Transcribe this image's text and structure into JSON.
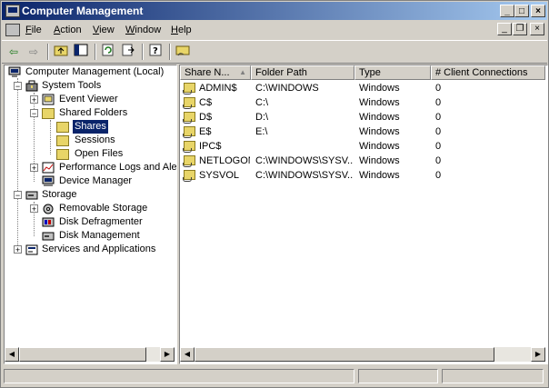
{
  "window": {
    "title": "Computer Management"
  },
  "menu": [
    {
      "label": "File",
      "accel": "F",
      "rest": "ile"
    },
    {
      "label": "Action",
      "accel": "A",
      "rest": "ction"
    },
    {
      "label": "View",
      "accel": "V",
      "rest": "iew"
    },
    {
      "label": "Window",
      "accel": "W",
      "rest": "indow"
    },
    {
      "label": "Help",
      "accel": "H",
      "rest": "elp"
    }
  ],
  "toolbar": {
    "icons": [
      "back-arrow-icon",
      "forward-arrow-icon",
      "up-folder-icon",
      "show-hide-tree-icon",
      "refresh-icon",
      "export-list-icon",
      "help-icon",
      "new-share-icon"
    ]
  },
  "tree": {
    "root": "Computer Management (Local)",
    "system_tools": "System Tools",
    "event_viewer": "Event Viewer",
    "shared_folders": "Shared Folders",
    "shares": "Shares",
    "sessions": "Sessions",
    "open_files": "Open Files",
    "performance_logs": "Performance Logs and Alerts",
    "device_manager": "Device Manager",
    "storage": "Storage",
    "removable_storage": "Removable Storage",
    "disk_defragmenter": "Disk Defragmenter",
    "disk_management": "Disk Management",
    "services_apps": "Services and Applications"
  },
  "list": {
    "columns": [
      "Share N...",
      "Folder Path",
      "Type",
      "# Client Connections"
    ],
    "rows": [
      {
        "name": "ADMIN$",
        "path": "C:\\WINDOWS",
        "type": "Windows",
        "connections": "0"
      },
      {
        "name": "C$",
        "path": "C:\\",
        "type": "Windows",
        "connections": "0"
      },
      {
        "name": "D$",
        "path": "D:\\",
        "type": "Windows",
        "connections": "0"
      },
      {
        "name": "E$",
        "path": "E:\\",
        "type": "Windows",
        "connections": "0"
      },
      {
        "name": "IPC$",
        "path": "",
        "type": "Windows",
        "connections": "0"
      },
      {
        "name": "NETLOGON",
        "path": "C:\\WINDOWS\\SYSV...",
        "type": "Windows",
        "connections": "0"
      },
      {
        "name": "SYSVOL",
        "path": "C:\\WINDOWS\\SYSV...",
        "type": "Windows",
        "connections": "0"
      }
    ]
  },
  "colors": {
    "title_start": "#0a246a",
    "title_end": "#a6caf0",
    "face": "#d4d0c8",
    "selection": "#0a246a"
  }
}
